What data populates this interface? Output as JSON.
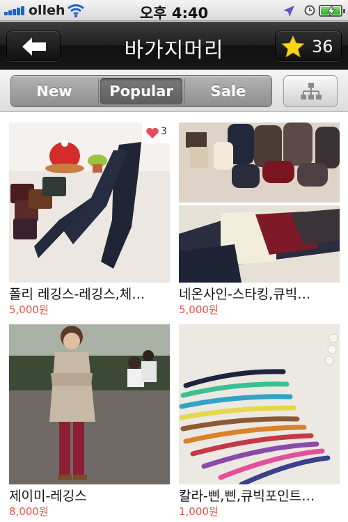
{
  "status_bar": {
    "carrier": "olleh",
    "time": "오후 4:40"
  },
  "nav": {
    "title": "바가지머리",
    "favorite_count": "36"
  },
  "tabs": [
    {
      "label": "New",
      "selected": false
    },
    {
      "label": "Popular",
      "selected": true
    },
    {
      "label": "Sale",
      "selected": false
    }
  ],
  "products": [
    {
      "name": "폴리 레깅스-레깅스,체…",
      "price": "5,000원",
      "likes": "3"
    },
    {
      "name": "네온사인-스타킹,큐빅…",
      "price": "5,000원"
    },
    {
      "name": "제이미-레깅스",
      "price": "8,000원"
    },
    {
      "name": "칼라-삔,삔,큐빅포인트…",
      "price": "1,000원"
    }
  ],
  "colors": {
    "price": "#e8504a",
    "like_heart": "#e94b5b",
    "star": "#f7d617"
  }
}
